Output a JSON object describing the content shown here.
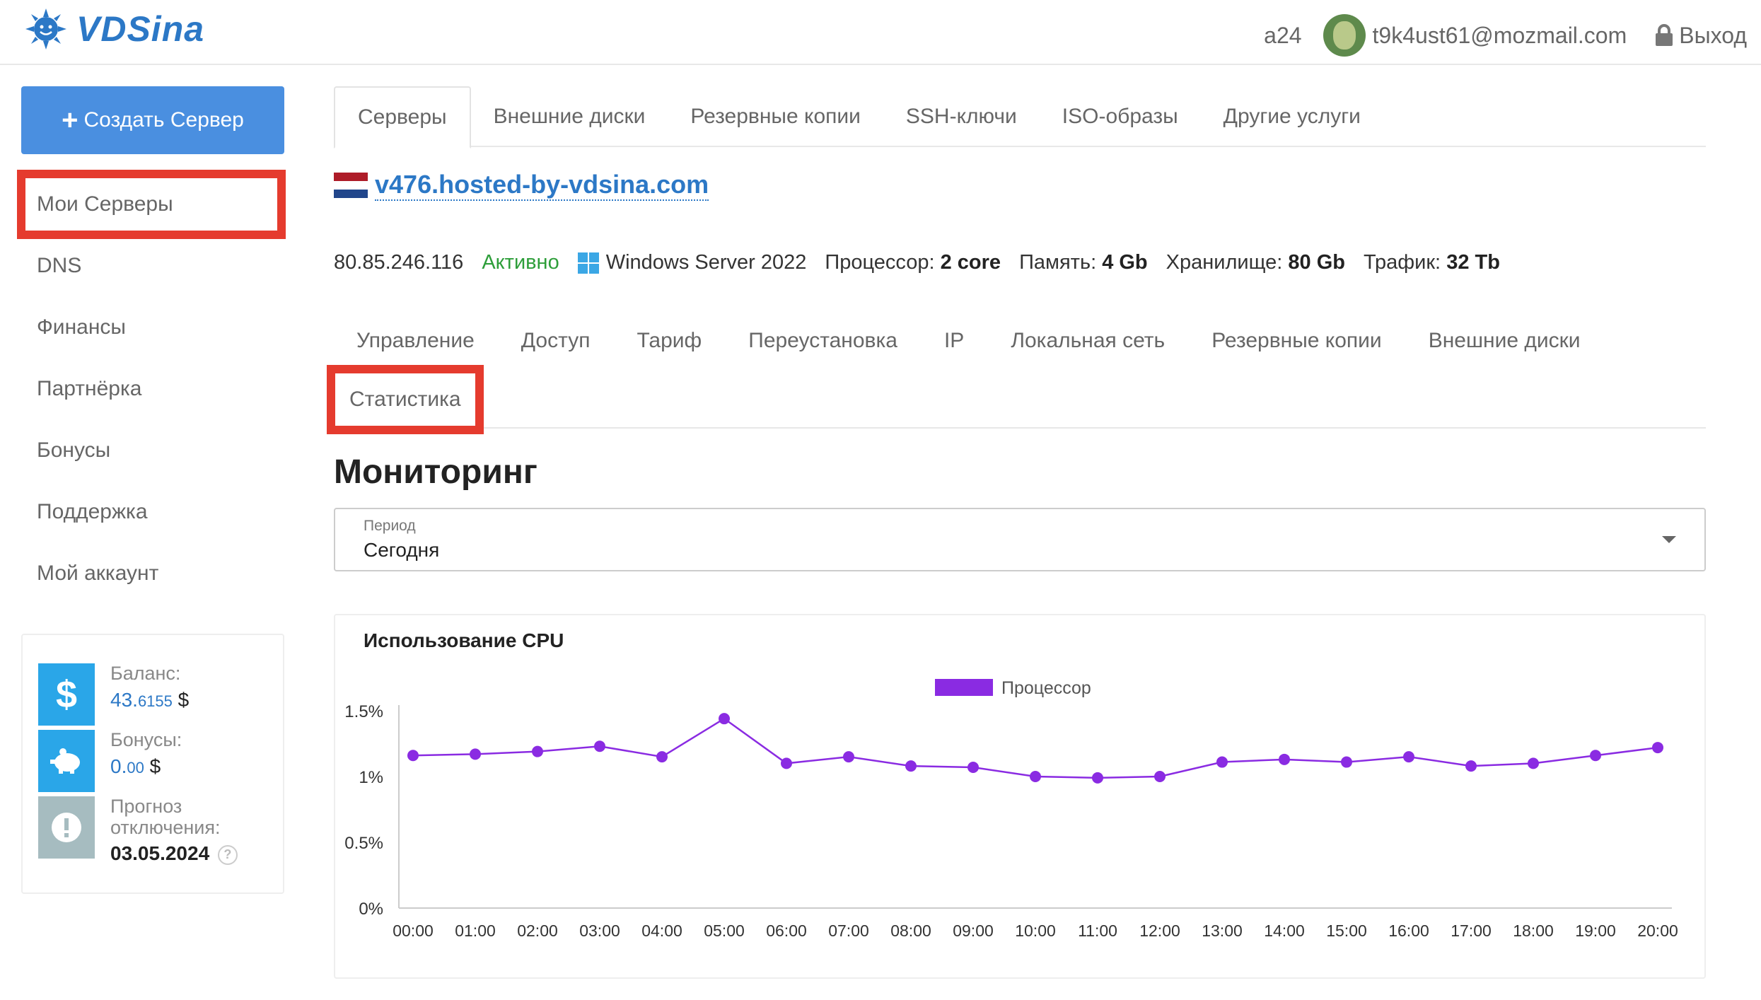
{
  "header": {
    "logo_text": "VDSina",
    "alias": "a24",
    "email": "t9k4ust61@mozmail.com",
    "logout_label": "Выход"
  },
  "sidebar": {
    "create_button": "Создать Сервер",
    "items": [
      {
        "label": "Мои Серверы",
        "active": true
      },
      {
        "label": "DNS"
      },
      {
        "label": "Финансы"
      },
      {
        "label": "Партнёрка"
      },
      {
        "label": "Бонусы"
      },
      {
        "label": "Поддержка"
      },
      {
        "label": "Мой аккаунт"
      }
    ],
    "balance": {
      "balance_label": "Баланс:",
      "balance_main": "43.",
      "balance_frac": "6155",
      "balance_currency": "$",
      "bonus_label": "Бонусы:",
      "bonus_main": "0.",
      "bonus_frac": "00",
      "bonus_currency": "$",
      "forecast_label_1": "Прогноз",
      "forecast_label_2": "отключения:",
      "forecast_date": "03.05.2024",
      "help": "?"
    }
  },
  "top_tabs": [
    {
      "label": "Серверы",
      "active": true
    },
    {
      "label": "Внешние диски"
    },
    {
      "label": "Резервные копии"
    },
    {
      "label": "SSH-ключи"
    },
    {
      "label": "ISO-образы"
    },
    {
      "label": "Другие услуги"
    }
  ],
  "server": {
    "hostname": "v476.hosted-by-vdsina.com",
    "flag_colors": [
      "#ae1c28",
      "#ffffff",
      "#21468b"
    ],
    "ip": "80.85.246.116",
    "status": "Активно",
    "os": "Windows Server 2022",
    "cpu_label": "Процессор:",
    "cpu_value": "2 core",
    "mem_label": "Память:",
    "mem_value": "4 Gb",
    "storage_label": "Хранилище:",
    "storage_value": "80 Gb",
    "traffic_label": "Трафик:",
    "traffic_value": "32 Tb"
  },
  "sub_tabs": [
    {
      "label": "Управление"
    },
    {
      "label": "Доступ"
    },
    {
      "label": "Тариф"
    },
    {
      "label": "Переустановка"
    },
    {
      "label": "IP"
    },
    {
      "label": "Локальная сеть"
    },
    {
      "label": "Резервные копии"
    },
    {
      "label": "Внешние диски"
    },
    {
      "label": "Статистика",
      "active": true
    }
  ],
  "monitoring": {
    "title": "Мониторинг",
    "period_label": "Период",
    "period_value": "Сегодня"
  },
  "colors": {
    "accent": "#4a8fe0",
    "link": "#2c78c6",
    "highlight": "#e53b2e",
    "series": "#8a2be2",
    "status_active": "#2e9e3a"
  },
  "chart_data": {
    "type": "line",
    "title": "Использование CPU",
    "xlabel": "",
    "ylabel": "",
    "legend_position": "top-center",
    "y_ticks": [
      "0%",
      "0.5%",
      "1%",
      "1.5%"
    ],
    "ylim": [
      0,
      1.5
    ],
    "categories": [
      "00:00",
      "01:00",
      "02:00",
      "03:00",
      "04:00",
      "05:00",
      "06:00",
      "07:00",
      "08:00",
      "09:00",
      "10:00",
      "11:00",
      "12:00",
      "13:00",
      "14:00",
      "15:00",
      "16:00",
      "17:00",
      "18:00",
      "19:00",
      "20:00"
    ],
    "series": [
      {
        "name": "Процессор",
        "color": "#8a2be2",
        "values": [
          1.16,
          1.17,
          1.19,
          1.23,
          1.15,
          1.44,
          1.1,
          1.15,
          1.08,
          1.07,
          1.0,
          0.99,
          1.0,
          1.11,
          1.13,
          1.11,
          1.15,
          1.08,
          1.1,
          1.16,
          1.22
        ]
      }
    ]
  }
}
